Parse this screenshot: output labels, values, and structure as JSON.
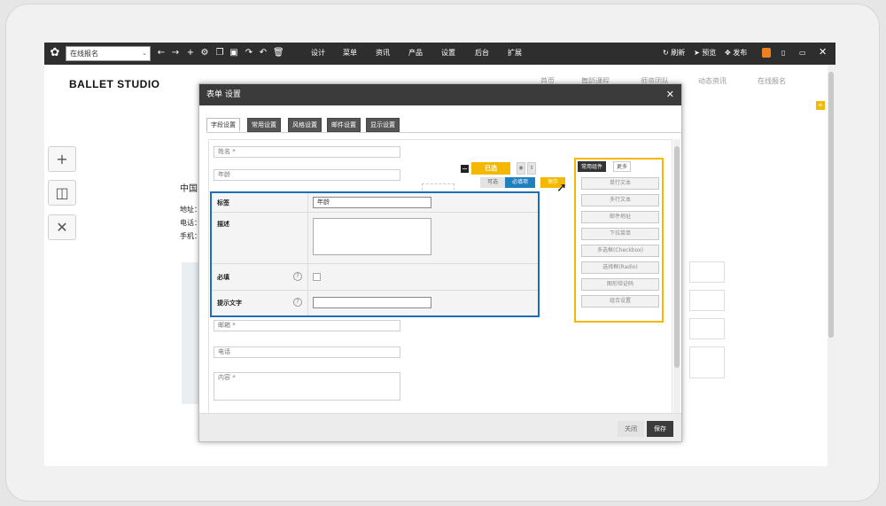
{
  "toolbar": {
    "page_select": "在线报名",
    "menu": [
      "设计",
      "菜单",
      "资讯",
      "产品",
      "设置",
      "后台",
      "扩展"
    ],
    "refresh": "刷新",
    "preview": "预览",
    "publish": "发布"
  },
  "site": {
    "brand": "BALLET STUDIO",
    "nav": [
      "首页",
      "舞蹈课程",
      "师资团队",
      "动态资讯",
      "在线报名"
    ]
  },
  "background": {
    "heading_fragment": "中国",
    "address_fragment": "地址：",
    "phone_fragment": "电话：",
    "mobile_fragment": "手机："
  },
  "modal": {
    "title": "表单 设置",
    "tabs": [
      "字段设置",
      "常用设置",
      "风格设置",
      "邮件设置",
      "显示设置"
    ],
    "fields": {
      "name": "姓名 *",
      "age": "年龄",
      "email": "邮箱 *",
      "phone": "电话",
      "content": "内容 *"
    },
    "field_controls": {
      "type_label": "已选",
      "optional": "可选",
      "required": "必填项",
      "save": "保存"
    },
    "props": {
      "label_caption": "标签",
      "label_value": "年龄",
      "desc_caption": "描述",
      "required_caption": "必填",
      "hint_caption": "提示文字",
      "help": "?"
    },
    "palette": {
      "tabs": [
        "常用组件",
        "更多"
      ],
      "items": [
        "单行文本",
        "多行文本",
        "邮件地址",
        "下拉菜单",
        "多选框(Checkbox)",
        "选择框(Radio)",
        "图形验证码",
        "组合设置"
      ]
    },
    "footer": {
      "close": "关闭",
      "save": "保存"
    }
  },
  "colors": {
    "accent_yellow": "#f5b800",
    "accent_blue": "#1a6fbb",
    "toolbar_bg": "#2e2e2e"
  }
}
